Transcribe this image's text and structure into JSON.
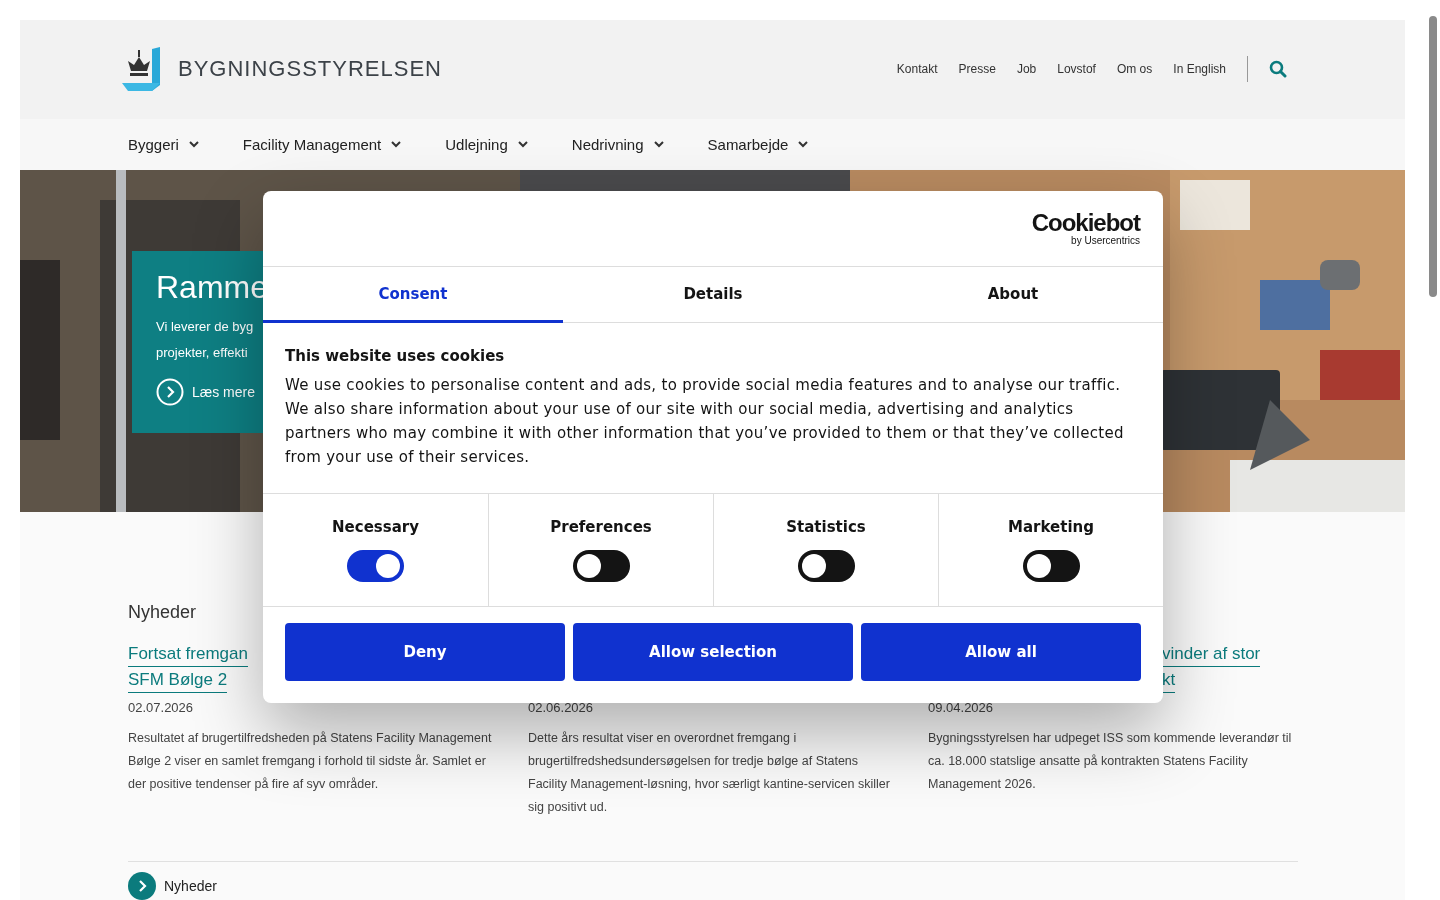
{
  "header": {
    "logo_text": "BYGNINGSSTYRELSEN",
    "utility_links": [
      "Kontakt",
      "Presse",
      "Job",
      "Lovstof",
      "Om os",
      "In English"
    ]
  },
  "nav": [
    "Byggeri",
    "Facility Management",
    "Udlejning",
    "Nedrivning",
    "Samarbejde"
  ],
  "hero": {
    "title": "Ramme",
    "text_lines": [
      "Vi leverer de byg",
      "projekter, effekti"
    ],
    "link": "Læs mere"
  },
  "news": {
    "heading": "Nyheder",
    "items": [
      {
        "title_lines": [
          "Fortsat fremgan",
          "SFM Bølge 2"
        ],
        "date": "02.07.2026",
        "summary": "Resultatet af brugertilfredsheden på Statens Facility Management Bølge 2 viser en samlet fremgang i forhold til sidste år. Samlet er der positive tendenser på fire af syv områder."
      },
      {
        "date": "02.06.2026",
        "summary": "Dette års resultat viser en overordnet fremgang i brugertilfredshedsundersøgelsen for tredje bølge af Statens Facility Management-løsning, hvor særligt kantine-servicen skiller sig positivt ud."
      },
      {
        "title_lines": [
          "vinder af stor",
          "kt"
        ],
        "date": "09.04.2026",
        "summary": "Bygningsstyrelsen har udpeget ISS som kommende leverandør til ca. 18.000 statslige ansatte på kontrakten Statens Facility Management 2026."
      }
    ],
    "more_link": "Nyheder"
  },
  "cookie_dialog": {
    "brand": "Cookiebot",
    "brand_sub": "by Usercentrics",
    "tabs": [
      {
        "label": "Consent",
        "selected": true
      },
      {
        "label": "Details",
        "selected": false
      },
      {
        "label": "About",
        "selected": false
      }
    ],
    "heading": "This website uses cookies",
    "text": "We use cookies to personalise content and ads, to provide social media features and to analyse our traffic. We also share information about your use of our site with our social media, advertising and analytics partners who may combine it with other information that you’ve provided to them or that they’ve collected from your use of their services.",
    "categories": [
      {
        "label": "Necessary",
        "checked": true
      },
      {
        "label": "Preferences",
        "checked": false
      },
      {
        "label": "Statistics",
        "checked": false
      },
      {
        "label": "Marketing",
        "checked": false
      }
    ],
    "buttons": [
      "Deny",
      "Allow selection",
      "Allow all"
    ]
  }
}
